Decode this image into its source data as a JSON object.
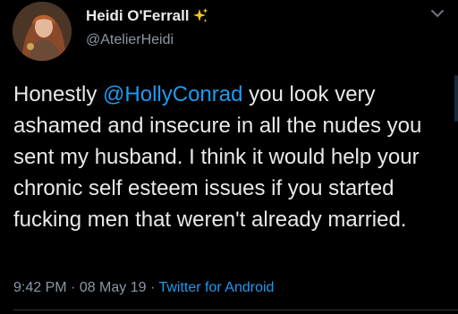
{
  "author": {
    "display_name": "Heidi O'Ferrall",
    "handle": "@AtelierHeidi",
    "name_emoji": "sparkles-icon"
  },
  "tweet": {
    "text_before_mention": "Honestly ",
    "mention": "@HollyConrad",
    "text_after_mention": " you look very ashamed and insecure in all the nudes you sent my husband. I think it would help your chronic self esteem issues if you started fucking men that weren't already married.",
    "time": "9:42 PM",
    "separator": " · ",
    "date": "08 May 19",
    "source": "Twitter for Android"
  },
  "colors": {
    "background": "#000000",
    "text": "#e7e9ea",
    "secondary": "#8b98a5",
    "link": "#1d9bf0"
  }
}
